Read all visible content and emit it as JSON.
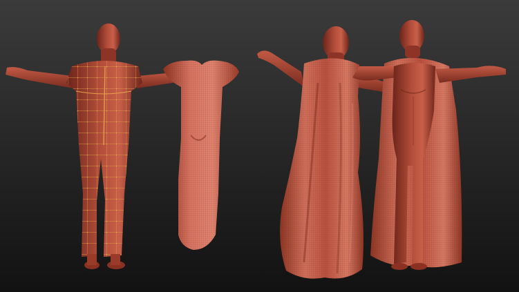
{
  "scene": {
    "background_top": "#3b3b3b",
    "background_bottom": "#121212",
    "clay_color": "#a4412f",
    "clay_highlight": "#d46a54",
    "clay_shadow": "#5a1d14",
    "wire_color": "#e7a24a",
    "figures": [
      {
        "name": "figure-back-with-topology-cage"
      },
      {
        "name": "cloth-tube-unwrapped"
      },
      {
        "name": "figure-back-with-cape"
      },
      {
        "name": "figure-front-with-cape"
      }
    ]
  }
}
